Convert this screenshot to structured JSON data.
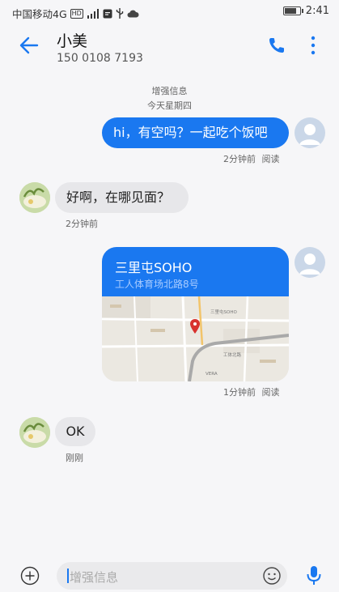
{
  "status_bar": {
    "carrier": "中国移动4G",
    "hd_badge": "HD",
    "network": "4G",
    "time": "2:41",
    "icons": [
      "hd-icon",
      "signal-icon",
      "message-icon",
      "usb-icon",
      "cloud-icon",
      "battery-icon"
    ]
  },
  "header": {
    "name": "小美",
    "phone": "150 0108 7193"
  },
  "messages": {
    "label": "增强信息",
    "day": "今天星期四",
    "m1": {
      "text": "hi，有空吗？一起吃个饭吧",
      "time": "2分钟前",
      "status": "阅读"
    },
    "m2": {
      "text": "好啊，在哪见面？",
      "time": "2分钟前"
    },
    "m3": {
      "title": "三里屯SOHO",
      "address": "工人体育场北路8号",
      "time": "1分钟前",
      "status": "阅读",
      "map_labels": [
        "三里屯SOHO",
        "工体北路",
        "VERA"
      ]
    },
    "m4": {
      "text": "OK",
      "time": "刚刚"
    }
  },
  "input": {
    "placeholder": "增强信息"
  },
  "colors": {
    "accent": "#1a78f0",
    "incoming_bubble": "#e7e7ea",
    "background": "#f6f6f8"
  }
}
